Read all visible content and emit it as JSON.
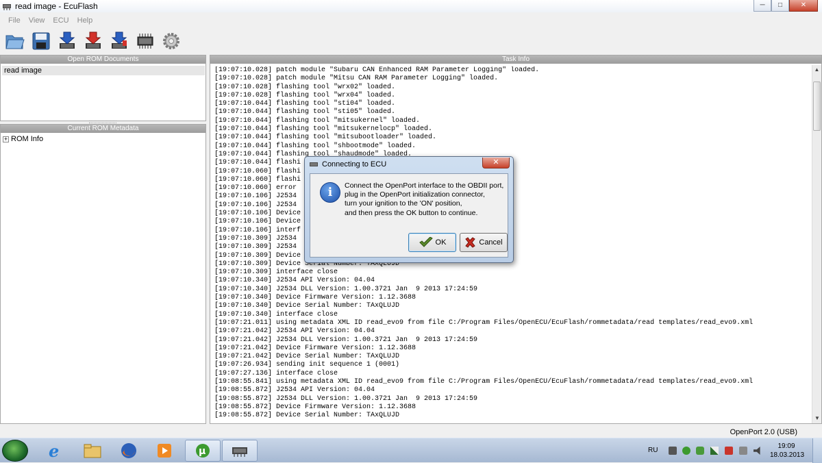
{
  "window": {
    "title": "read image - EcuFlash",
    "minimize": "─",
    "maximize": "□",
    "close": "✕"
  },
  "menu": [
    "File",
    "View",
    "ECU",
    "Help"
  ],
  "toolbar": [
    {
      "icon": "open-folder-icon"
    },
    {
      "icon": "save-icon"
    },
    {
      "icon": "read-rom-icon"
    },
    {
      "icon": "write-rom-icon"
    },
    {
      "icon": "test-write-icon"
    },
    {
      "icon": "chip-icon"
    },
    {
      "icon": "settings-gear-icon"
    }
  ],
  "panels": {
    "open_rom": {
      "header": "Open ROM Documents",
      "items": [
        "read image"
      ]
    },
    "metadata": {
      "header": "Current ROM Metadata",
      "tree": [
        "ROM Info"
      ]
    },
    "task": {
      "header": "Task Info"
    }
  },
  "log": [
    "[19:07:10.028] patch module \"Subaru CAN Enhanced RAM Parameter Logging\" loaded.",
    "[19:07:10.028] patch module \"Mitsu CAN RAM Parameter Logging\" loaded.",
    "[19:07:10.028] flashing tool \"wrx02\" loaded.",
    "[19:07:10.028] flashing tool \"wrx04\" loaded.",
    "[19:07:10.044] flashing tool \"sti04\" loaded.",
    "[19:07:10.044] flashing tool \"sti05\" loaded.",
    "[19:07:10.044] flashing tool \"mitsukernel\" loaded.",
    "[19:07:10.044] flashing tool \"mitsukernelocp\" loaded.",
    "[19:07:10.044] flashing tool \"mitsubootloader\" loaded.",
    "[19:07:10.044] flashing tool \"shbootmode\" loaded.",
    "[19:07:10.044] flashing tool \"shaudmode\" loaded.",
    "[19:07:10.044] flashi",
    "[19:07:10.060] flashi",
    "[19:07:10.060] flashi",
    "[19:07:10.060] error",
    "[19:07:10.106] J2534",
    "[19:07:10.106] J2534",
    "[19:07:10.106] Device",
    "[19:07:10.106] Device",
    "[19:07:10.106] interf",
    "[19:07:10.309] J2534",
    "[19:07:10.309] J2534",
    "[19:07:10.309] Device",
    "[19:07:10.309] Device Serial Number: TAXQLUJD",
    "[19:07:10.309] interface close",
    "[19:07:10.340] J2534 API Version: 04.04",
    "[19:07:10.340] J2534 DLL Version: 1.00.3721 Jan  9 2013 17:24:59",
    "[19:07:10.340] Device Firmware Version: 1.12.3688",
    "[19:07:10.340] Device Serial Number: TAxQLUJD",
    "[19:07:10.340] interface close",
    "[19:07:21.011] using metadata XML ID read_evo9 from file C:/Program Files/OpenECU/EcuFlash/rommetadata/read templates/read_evo9.xml",
    "[19:07:21.042] J2534 API Version: 04.04",
    "[19:07:21.042] J2534 DLL Version: 1.00.3721 Jan  9 2013 17:24:59",
    "[19:07:21.042] Device Firmware Version: 1.12.3688",
    "[19:07:21.042] Device Serial Number: TAxQLUJD",
    "[19:07:26.934] sending init sequence 1 (0001)",
    "[19:07:27.136] interface close",
    "[19:08:55.841] using metadata XML ID read_evo9 from file C:/Program Files/OpenECU/EcuFlash/rommetadata/read templates/read_evo9.xml",
    "[19:08:55.872] J2534 API Version: 04.04",
    "[19:08:55.872] J2534 DLL Version: 1.00.3721 Jan  9 2013 17:24:59",
    "[19:08:55.872] Device Firmware Version: 1.12.3688",
    "[19:08:55.872] Device Serial Number: TAxQLUJD"
  ],
  "status": {
    "text": "OpenPort 2.0 (USB)"
  },
  "dialog": {
    "title": "Connecting to ECU",
    "close": "✕",
    "icon": "info-icon",
    "info_glyph": "i",
    "message": [
      "Connect the OpenPort interface to the OBDII port,",
      "plug in the OpenPort initialization connector,",
      "turn your ignition to the 'ON' position,",
      "and then press the OK button to continue."
    ],
    "ok_label": "OK",
    "cancel_label": "Cancel"
  },
  "taskbar": {
    "apps": [
      "start-orb-icon",
      "internet-explorer-icon",
      "explorer-folder-icon",
      "firefox-icon",
      "media-player-icon",
      "utorrent-icon",
      "ecuflash-icon"
    ],
    "lang": "RU",
    "time": "19:09",
    "date": "18.03.2013"
  }
}
